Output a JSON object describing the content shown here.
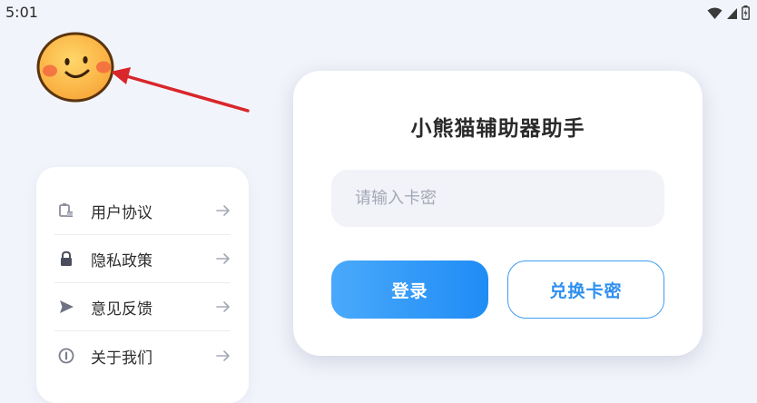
{
  "status_bar": {
    "time": "5:01",
    "icons": [
      "wifi-icon",
      "signal-icon",
      "battery-icon"
    ]
  },
  "avatar": {
    "icon": "smiley-face-icon"
  },
  "annotation": {
    "icon": "red-arrow-icon",
    "color": "#d9262b"
  },
  "menu": {
    "items": [
      {
        "label": "用户协议",
        "icon": "agreement-icon"
      },
      {
        "label": "隐私政策",
        "icon": "lock-icon"
      },
      {
        "label": "意见反馈",
        "icon": "send-icon"
      },
      {
        "label": "关于我们",
        "icon": "info-icon"
      }
    ],
    "arrow_icon": "arrow-right-icon"
  },
  "login": {
    "title": "小熊猫辅助器助手",
    "input_placeholder": "请输入卡密",
    "input_value": "",
    "login_label": "登录",
    "redeem_label": "兑换卡密"
  },
  "colors": {
    "accent": "#2a8ff5",
    "background": "#f2f4fb",
    "card": "#ffffff"
  }
}
